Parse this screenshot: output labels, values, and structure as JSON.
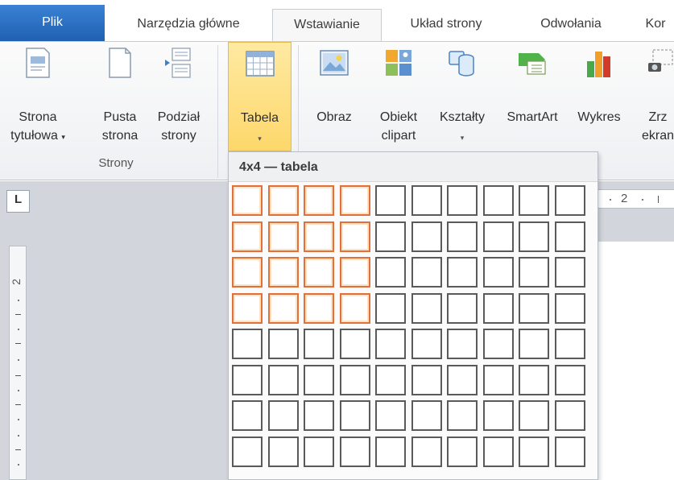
{
  "tabs": [
    {
      "label": "Plik"
    },
    {
      "label": "Narzędzia główne"
    },
    {
      "label": "Wstawianie"
    },
    {
      "label": "Układ strony"
    },
    {
      "label": "Odwołania"
    },
    {
      "label": "Kor"
    }
  ],
  "ribbon": {
    "group_pages_label": "Strony",
    "buttons": [
      {
        "line1": "Strona",
        "line2": "tytułowa",
        "icon": "cover-page-icon",
        "has_arrow": true
      },
      {
        "line1": "Pusta",
        "line2": "strona",
        "icon": "blank-page-icon"
      },
      {
        "line1": "Podział",
        "line2": "strony",
        "icon": "page-break-icon"
      },
      {
        "line1": "Tabela",
        "line2": "",
        "icon": "table-icon",
        "has_arrow": true
      },
      {
        "line1": "Obraz",
        "line2": "",
        "icon": "picture-icon"
      },
      {
        "line1": "Obiekt",
        "line2": "clipart",
        "icon": "clipart-icon"
      },
      {
        "line1": "Kształty",
        "line2": "",
        "icon": "shapes-icon",
        "has_arrow": true
      },
      {
        "line1": "SmartArt",
        "line2": "",
        "icon": "smartart-icon"
      },
      {
        "line1": "Wykres",
        "line2": "",
        "icon": "chart-icon"
      },
      {
        "line1": "Zrz",
        "line2": "ekran",
        "icon": "screenshot-icon"
      }
    ],
    "arrow_glyph": "▾"
  },
  "table_dropdown": {
    "header": "4x4 — tabela",
    "grid_cols": 10,
    "grid_rows": 8,
    "selected_cols": 4,
    "selected_rows": 4
  },
  "ruler": {
    "corner_glyph": "L",
    "vertical_number": "2",
    "horizontal_number": "2"
  },
  "colors": {
    "file_tab": "#2a6ec4",
    "selection_border": "#e2703a",
    "pressed_button": "#fdd76b"
  }
}
